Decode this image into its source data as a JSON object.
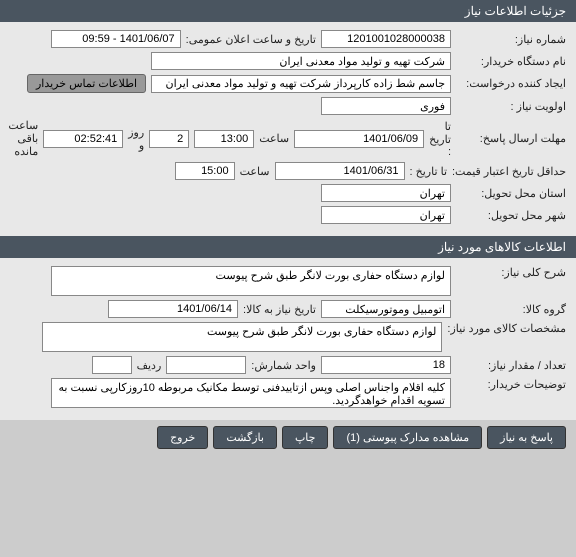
{
  "header1": {
    "title": "جزئیات اطلاعات نیاز"
  },
  "sec1": {
    "need_no_label": "شماره نیاز:",
    "need_no": "1201001028000038",
    "announce_label": "تاریخ و ساعت اعلان عمومی:",
    "announce_value": "1401/06/07 - 09:59",
    "buyer_label": "نام دستگاه خریدار:",
    "buyer": "شرکت تهیه و تولید مواد معدنی ایران",
    "requester_label": "ایجاد کننده درخواست:",
    "requester": "جاسم شط زاده کارپرداز شرکت تهیه و تولید مواد معدنی ایران",
    "contact_btn": "اطلاعات تماس خریدار",
    "priority_label": "اولویت نیاز :",
    "priority": "فوری",
    "send_deadline_label": "مهلت ارسال پاسخ:",
    "to_date_label": "تا تاریخ :",
    "send_date": "1401/06/09",
    "time_label": "ساعت",
    "send_time": "13:00",
    "day_count": "2",
    "day_label": "روز و",
    "remain_time": "02:52:41",
    "remain_label": "ساعت باقی مانده",
    "price_validity_label": "حداقل تاریخ اعتبار قیمت:",
    "price_date": "1401/06/31",
    "price_time": "15:00",
    "delivery_province_label": "استان محل تحویل:",
    "delivery_province": "تهران",
    "delivery_city_label": "شهر محل تحویل:",
    "delivery_city": "تهران"
  },
  "header2": {
    "title": "اطلاعات کالاهای مورد نیاز"
  },
  "sec2": {
    "desc_label": "شرح کلی نیاز:",
    "desc": "لوازم دستگاه حفاری بورت لانگر طبق شرح پیوست",
    "group_label": "گروه کالا:",
    "group": "اتومبیل وموتورسیکلت",
    "need_date_label": "تاریخ نیاز به کالا:",
    "need_date": "1401/06/14",
    "spec_label": "مشخصات کالای مورد نیاز:",
    "spec": "لوازم دستگاه حفاری بورت لانگر طبق شرح پیوست",
    "qty_label": "تعداد / مقدار نیاز:",
    "qty": "18",
    "unit_label": "واحد شمارش:",
    "row_label": "ردیف",
    "notes_label": "توضیحات خریدار:",
    "notes": "کلیه اقلام واجناس اصلی وپس ازتاییدفنی توسط مکانیک مربوطه 10روزکارپی نسبت به تسویه اقدام خواهدگردید."
  },
  "footer": {
    "reply": "پاسخ به نیاز",
    "attachments": "مشاهده مدارک پیوستی (1)",
    "print": "چاپ",
    "back": "بازگشت",
    "exit": "خروج"
  }
}
